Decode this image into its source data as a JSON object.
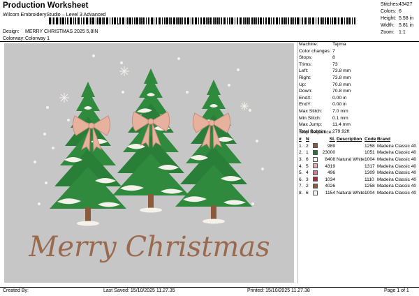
{
  "header": {
    "title": "Production Worksheet",
    "subtitle": "Wilcom EmbroideryStudio – Level 3 Advanced",
    "barcode_text": "*"
  },
  "summary": [
    {
      "label": "Stitches:",
      "value": "43427"
    },
    {
      "label": "Colors:",
      "value": "6"
    },
    {
      "label": "Height:",
      "value": "5.58 in"
    },
    {
      "label": "Width:",
      "value": "5.81 in"
    },
    {
      "label": "Zoom:",
      "value": "1:1"
    }
  ],
  "info": [
    {
      "label": "Design:",
      "value": "MERRY CHRISTMAS 2025 5,8IN"
    },
    {
      "label": "Colorway:",
      "value": "Colorway 1"
    }
  ],
  "details": [
    {
      "label": "Machine:",
      "value": "Tajima"
    },
    {
      "label": "Color changes:",
      "value": "7"
    },
    {
      "label": "Stops:",
      "value": "8"
    },
    {
      "label": "Trims:",
      "value": "73"
    },
    {
      "label": "Left:",
      "value": "73.8 mm"
    },
    {
      "label": "Right:",
      "value": "73.8 mm"
    },
    {
      "label": "Up:",
      "value": "70.8 mm"
    },
    {
      "label": "Down:",
      "value": "70.8 mm"
    },
    {
      "label": "EndX:",
      "value": "0.00 in"
    },
    {
      "label": "EndY:",
      "value": "0.00 in"
    },
    {
      "label": "Max Stitch:",
      "value": "7.0 mm"
    },
    {
      "label": "Min Stitch:",
      "value": "0.1 mm"
    },
    {
      "label": "Max Jump:",
      "value": "11.4 mm"
    },
    {
      "label": "Total Bobbin:",
      "value": "279.92ft"
    }
  ],
  "stop_sequence": {
    "title": "Stop Sequence:",
    "headers": [
      "#",
      "N",
      "",
      "St.",
      "Description",
      "Code",
      "Brand"
    ],
    "rows": [
      {
        "num": "1.",
        "n": "2",
        "color": "#8a5a3a",
        "st": "989",
        "desc": "",
        "code": "1258",
        "brand": "Madeira Classic 40"
      },
      {
        "num": "2.",
        "n": "1",
        "color": "#1e7a3c",
        "st": "23000",
        "desc": "",
        "code": "1051",
        "brand": "Madeira Classic 40"
      },
      {
        "num": "3.",
        "n": "6",
        "color": "#f2f0ea",
        "st": "8408",
        "desc": "Natural White",
        "code": "1004",
        "brand": "Madeira Classic 40"
      },
      {
        "num": "4.",
        "n": "5",
        "color": "#e8a9b0",
        "st": "4319",
        "desc": "",
        "code": "1317",
        "brand": "Madeira Classic 40"
      },
      {
        "num": "5.",
        "n": "4",
        "color": "#d07a9a",
        "st": "496",
        "desc": "",
        "code": "1309",
        "brand": "Madeira Classic 40"
      },
      {
        "num": "6.",
        "n": "3",
        "color": "#b0233a",
        "st": "1034",
        "desc": "",
        "code": "1110",
        "brand": "Madeira Classic 40"
      },
      {
        "num": "7.",
        "n": "2",
        "color": "#8a5a3a",
        "st": "4026",
        "desc": "",
        "code": "1258",
        "brand": "Madeira Classic 40"
      },
      {
        "num": "8.",
        "n": "6",
        "color": "#f2f0ea",
        "st": "1154",
        "desc": "Natural White",
        "code": "1004",
        "brand": "Madeira Classic 40"
      }
    ]
  },
  "design": {
    "text": "Merry Christmas",
    "text_color": "#9a6a4e",
    "tree_color": "#2f8a3e",
    "snow_color": "#f4f2ea",
    "bow_color": "#e6b29e",
    "trunk_color": "#8a5a3a"
  },
  "footer": {
    "created_by": "Created By:",
    "last_saved": "Last Saved: 15/10/2025 11.27.35",
    "printed": "Printed: 15/10/2025 11.27.38",
    "page": "Page 1 of 1"
  }
}
